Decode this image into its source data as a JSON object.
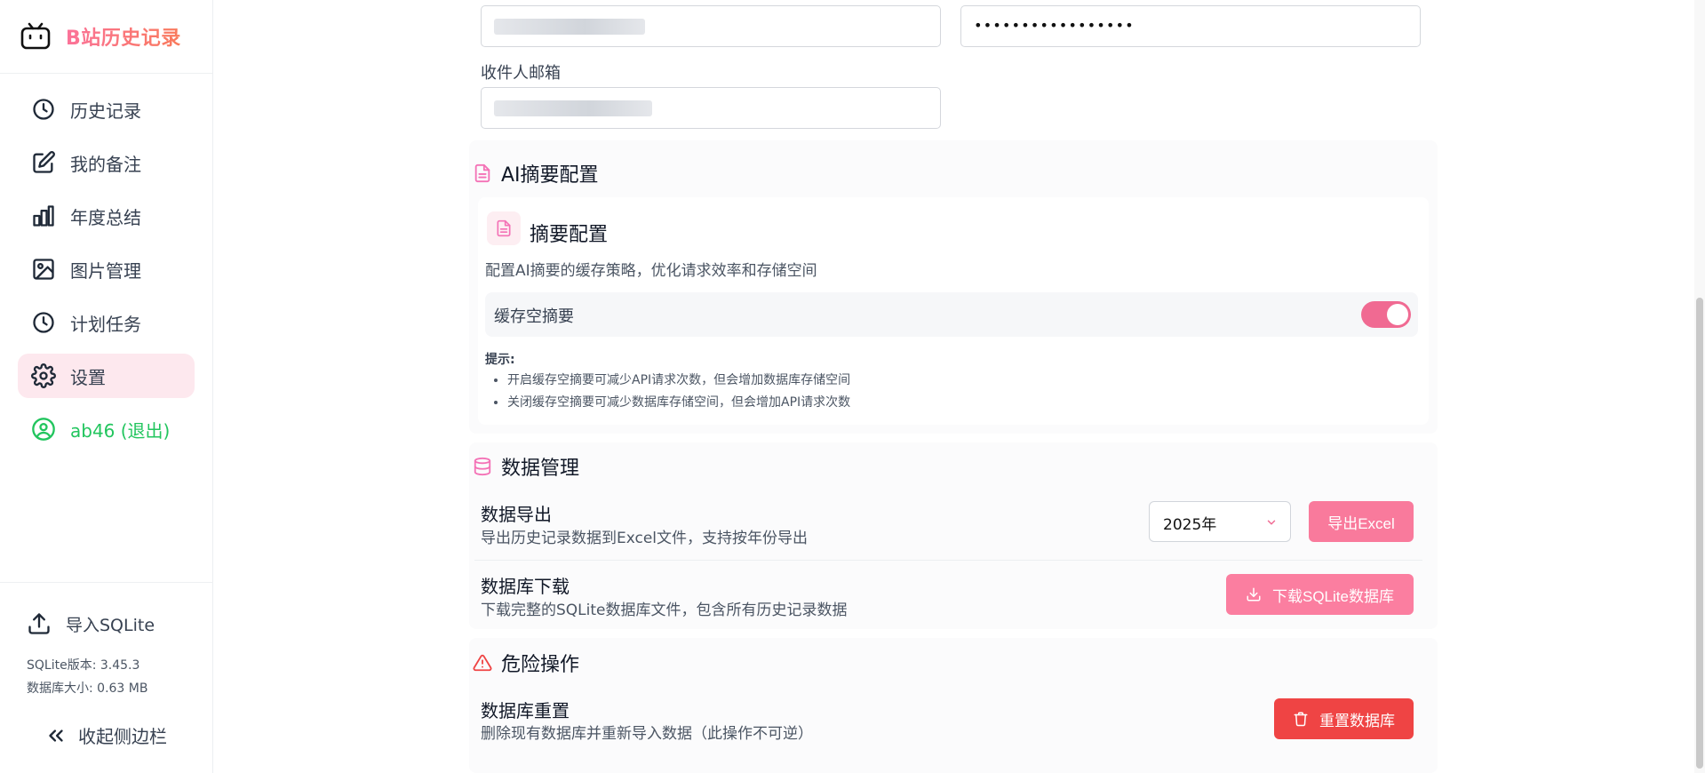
{
  "app": {
    "brand_title": "B站历史记录"
  },
  "sidebar": {
    "items": [
      {
        "label": "历史记录",
        "icon": "clock-icon"
      },
      {
        "label": "我的备注",
        "icon": "edit-icon"
      },
      {
        "label": "年度总结",
        "icon": "bar-chart-icon"
      },
      {
        "label": "图片管理",
        "icon": "image-icon"
      },
      {
        "label": "计划任务",
        "icon": "clock-icon"
      },
      {
        "label": "设置",
        "icon": "gear-icon",
        "active": true
      },
      {
        "label": "ab46 (退出)",
        "icon": "user-circle-icon"
      }
    ],
    "import_label": "导入SQLite",
    "sqlite_version": "SQLite版本: 3.45.3",
    "db_size": "数据库大小: 0.63 MB",
    "collapse_label": "收起侧边栏"
  },
  "email": {
    "password_mask": "•••••••••••••••••",
    "recipient_label": "收件人邮箱"
  },
  "ai_summary": {
    "section_title": "AI摘要配置",
    "card_title": "摘要配置",
    "card_desc": "配置AI摘要的缓存策略，优化请求效率和存储空间",
    "toggle_label": "缓存空摘要",
    "toggle_on": true,
    "tips_title": "提示:",
    "tips": [
      "开启缓存空摘要可减少API请求次数，但会增加数据库存储空间",
      "关闭缓存空摘要可减少数据库存储空间，但会增加API请求次数"
    ]
  },
  "data_mgmt": {
    "section_title": "数据管理",
    "export_title": "数据导出",
    "export_desc": "导出历史记录数据到Excel文件，支持按年份导出",
    "year_value": "2025年",
    "export_button": "导出Excel",
    "download_title": "数据库下载",
    "download_desc": "下载完整的SQLite数据库文件，包含所有历史记录数据",
    "download_button": "下载SQLite数据库"
  },
  "danger": {
    "section_title": "危险操作",
    "reset_title": "数据库重置",
    "reset_desc": "删除现有数据库并重新导入数据（此操作不可逆）",
    "reset_button": "重置数据库"
  },
  "colors": {
    "accent_pink": "#fb7299",
    "danger_red": "#ef4444",
    "success_green": "#22c55e"
  }
}
